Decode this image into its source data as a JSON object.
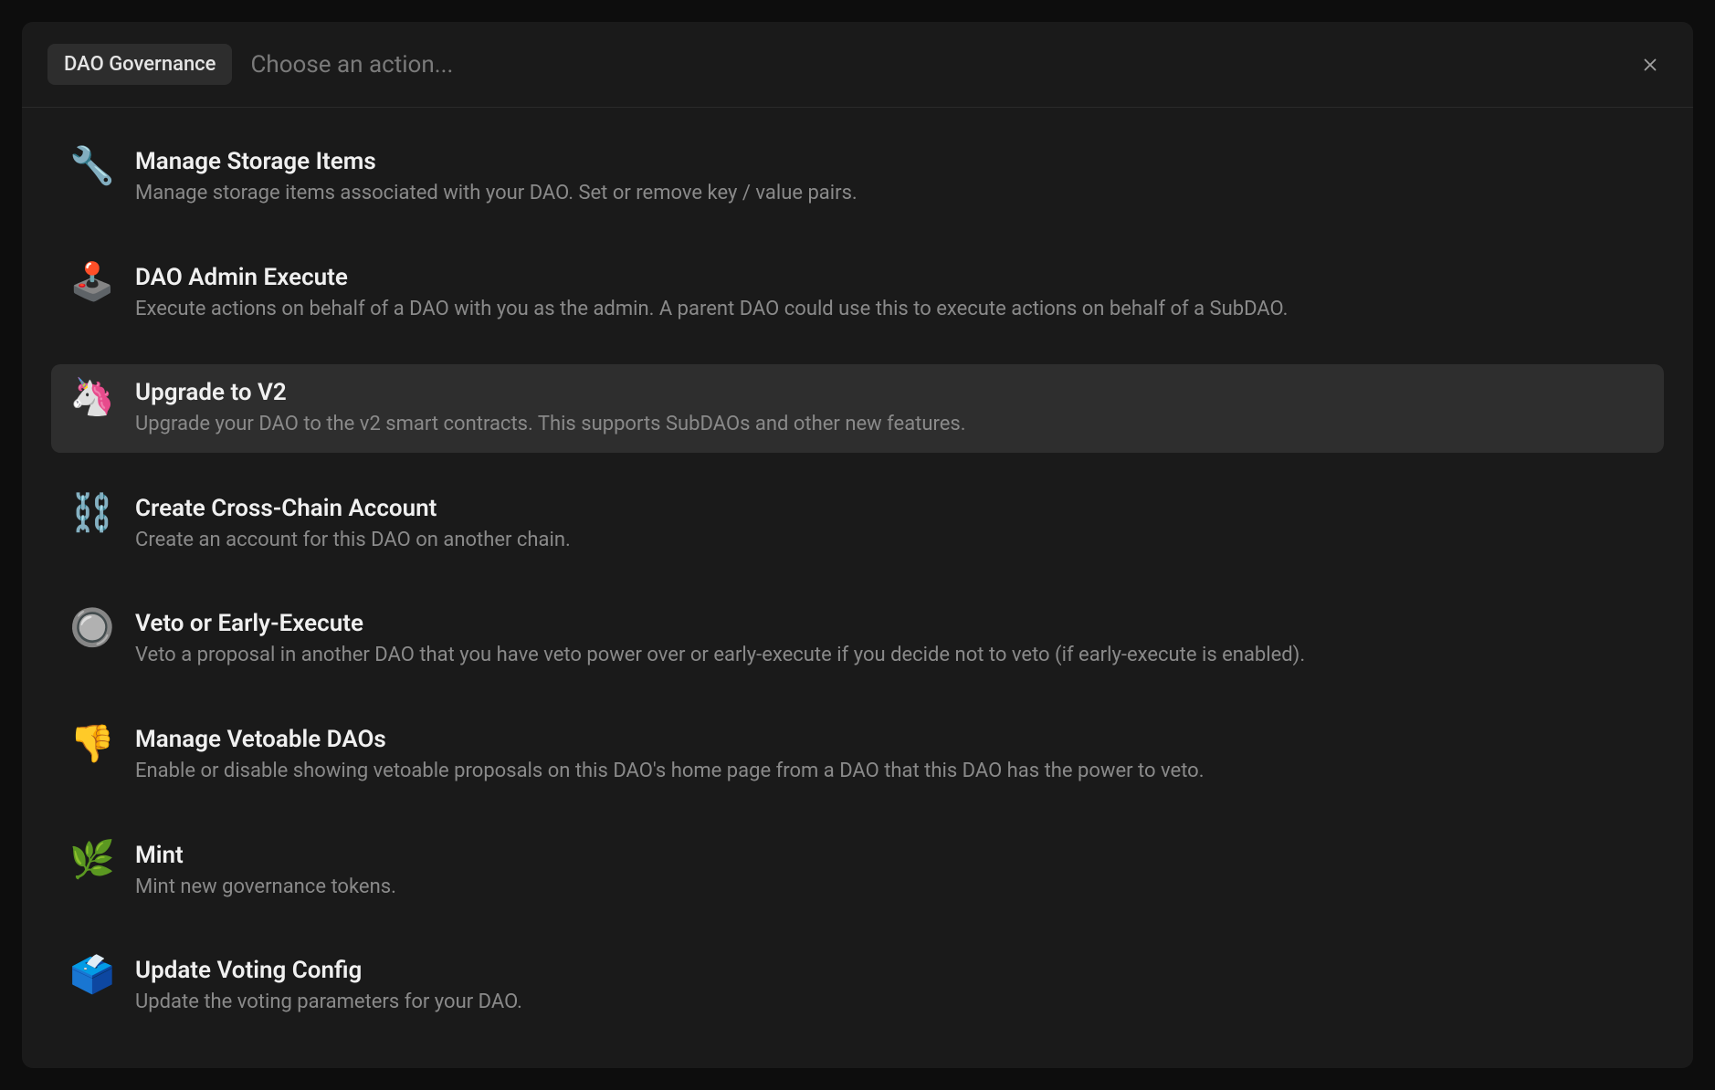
{
  "header": {
    "badge": "DAO Governance",
    "placeholder": "Choose an action..."
  },
  "actions": [
    {
      "icon": "🔧",
      "title": "Manage Storage Items",
      "description": "Manage storage items associated with your DAO. Set or remove key / value pairs.",
      "highlighted": false
    },
    {
      "icon": "🕹️",
      "title": "DAO Admin Execute",
      "description": "Execute actions on behalf of a DAO with you as the admin. A parent DAO could use this to execute actions on behalf of a SubDAO.",
      "highlighted": false
    },
    {
      "icon": "🦄",
      "title": "Upgrade to V2",
      "description": "Upgrade your DAO to the v2 smart contracts. This supports SubDAOs and other new features.",
      "highlighted": true
    },
    {
      "icon": "⛓️",
      "title": "Create Cross-Chain Account",
      "description": "Create an account for this DAO on another chain.",
      "highlighted": false
    },
    {
      "icon": "🔘",
      "title": "Veto or Early-Execute",
      "description": "Veto a proposal in another DAO that you have veto power over or early-execute if you decide not to veto (if early-execute is enabled).",
      "highlighted": false
    },
    {
      "icon": "👎",
      "title": "Manage Vetoable DAOs",
      "description": "Enable or disable showing vetoable proposals on this DAO's home page from a DAO that this DAO has the power to veto.",
      "highlighted": false
    },
    {
      "icon": "🌿",
      "title": "Mint",
      "description": "Mint new governance tokens.",
      "highlighted": false
    },
    {
      "icon": "🗳️",
      "title": "Update Voting Config",
      "description": "Update the voting parameters for your DAO.",
      "highlighted": false
    }
  ]
}
